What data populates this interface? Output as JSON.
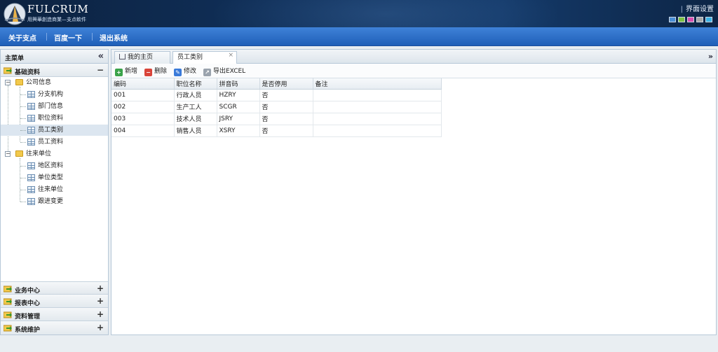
{
  "header": {
    "logo_text": "FULCRUM",
    "logo_sub": "用興華創造商業—支点軟件",
    "settings_label": "界面设置",
    "theme_colors": [
      "#4a8fd6",
      "#7cc142",
      "#d94fb0",
      "#a7a7a7",
      "#3db3e6"
    ]
  },
  "nav": {
    "items": [
      "关于支点",
      "百度一下",
      "退出系统"
    ]
  },
  "sidebar": {
    "title": "主菜单",
    "collapse_icon": "«",
    "open_section": {
      "label": "基础资料",
      "toggle": "−"
    },
    "tree": {
      "group1": {
        "label": "公司信息",
        "exp": "−"
      },
      "g1_items": [
        "分支机构",
        "部门信息",
        "职位资料",
        "员工类别",
        "员工资料"
      ],
      "group2": {
        "label": "往来单位",
        "exp": "−"
      },
      "g2_items": [
        "地区资料",
        "单位类型",
        "往来单位",
        "跟进变更"
      ],
      "selected": "员工类别"
    },
    "sections": [
      {
        "label": "业务中心",
        "toggle": "+"
      },
      {
        "label": "报表中心",
        "toggle": "+"
      },
      {
        "label": "资料管理",
        "toggle": "+"
      },
      {
        "label": "系统维护",
        "toggle": "+"
      }
    ]
  },
  "main": {
    "tabs": [
      {
        "label": "我的主页"
      },
      {
        "label": "员工类别",
        "close": "×"
      }
    ],
    "more_icon": "»",
    "toolbar": {
      "add": "新增",
      "delete": "删除",
      "edit": "修改",
      "export": "导出EXCEL"
    },
    "table": {
      "headers": [
        "编码",
        "职位名称",
        "拼音码",
        "是否停用",
        "备注"
      ],
      "rows": [
        [
          "001",
          "行政人员",
          "HZRY",
          "否",
          ""
        ],
        [
          "002",
          "生产工人",
          "SCGR",
          "否",
          ""
        ],
        [
          "003",
          "技术人员",
          "JSRY",
          "否",
          ""
        ],
        [
          "004",
          "销售人员",
          "XSRY",
          "否",
          ""
        ]
      ]
    }
  },
  "colors": {
    "header_bg": "#10305a",
    "nav_bg": "#2b6cc8",
    "selected_row": "#dce6f0"
  }
}
